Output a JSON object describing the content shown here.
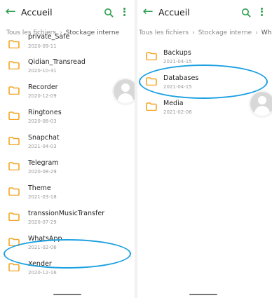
{
  "colors": {
    "accent": "#2e9e4f",
    "folder": "#f5a623",
    "annotation": "#1ba0e0"
  },
  "left_pane": {
    "title": "Accueil",
    "breadcrumb": [
      "Tous les fichiers",
      "Stockage interne"
    ],
    "folders": [
      {
        "name": "private_Safe",
        "date": "2020-09-11"
      },
      {
        "name": "Qidian_Transread",
        "date": "2020-10-31"
      },
      {
        "name": "Recorder",
        "date": "2020-12-09"
      },
      {
        "name": "Ringtones",
        "date": "2020-08-03"
      },
      {
        "name": "Snapchat",
        "date": "2021-04-03"
      },
      {
        "name": "Telegram",
        "date": "2020-08-29"
      },
      {
        "name": "Theme",
        "date": "2021-03-18"
      },
      {
        "name": "transsionMusicTransfer",
        "date": "2020-07-29"
      },
      {
        "name": "WhatsApp",
        "date": "2021-02-06"
      },
      {
        "name": "Xender",
        "date": "2020-12-16"
      }
    ]
  },
  "right_pane": {
    "title": "Accueil",
    "breadcrumb": [
      "Tous les fichiers",
      "Stockage interne",
      "WhatsApp"
    ],
    "folders": [
      {
        "name": "Backups",
        "date": "2021-04-15"
      },
      {
        "name": "Databases",
        "date": "2021-04-15"
      },
      {
        "name": "Media",
        "date": "2021-02-06"
      }
    ]
  }
}
